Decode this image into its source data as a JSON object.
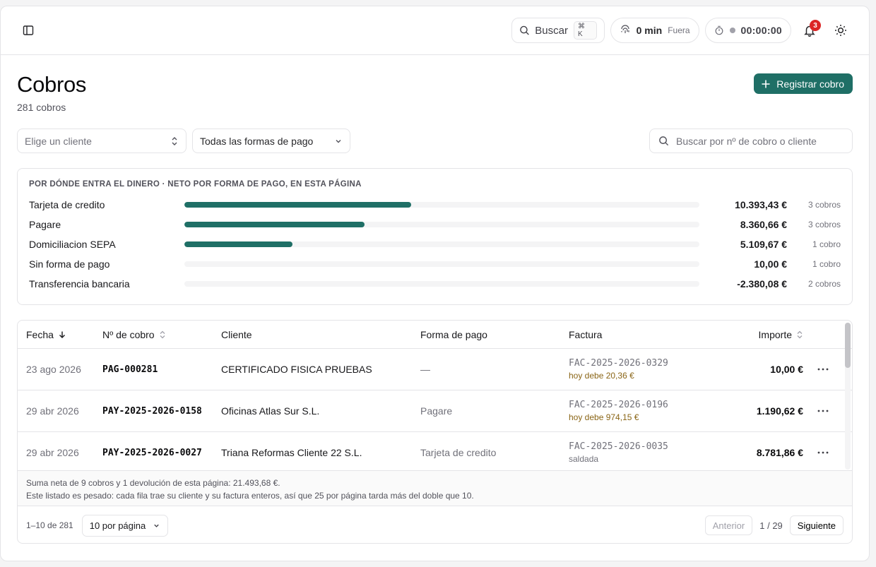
{
  "topbar": {
    "search_label": "Buscar",
    "search_shortcut": "⌘ K",
    "presence_minutes": "0 min",
    "presence_status": "Fuera",
    "timer": "00:00:00",
    "notifications_count": "3"
  },
  "page": {
    "title": "Cobros",
    "subtitle": "281 cobros",
    "primary_action": "Registrar cobro"
  },
  "filters": {
    "client_placeholder": "Elige un cliente",
    "payment_method": "Todas las formas de pago",
    "search_placeholder": "Buscar por nº de cobro o cliente"
  },
  "summary": {
    "title": "POR DÓNDE ENTRA EL DINERO · NETO POR FORMA DE PAGO, EN ESTA PÁGINA",
    "rows": [
      {
        "label": "Tarjeta de credito",
        "amount": "10.393,43 €",
        "count": "3 cobros",
        "share": 0.44
      },
      {
        "label": "Pagare",
        "amount": "8.360,66 €",
        "count": "3 cobros",
        "share": 0.35
      },
      {
        "label": "Domiciliacion SEPA",
        "amount": "5.109,67 €",
        "count": "1 cobro",
        "share": 0.21
      },
      {
        "label": "Sin forma de pago",
        "amount": "10,00 €",
        "count": "1 cobro",
        "share": 0
      },
      {
        "label": "Transferencia bancaria",
        "amount": "-2.380,08 €",
        "count": "2 cobros",
        "share": 0
      }
    ]
  },
  "table": {
    "columns": {
      "fecha": "Fecha",
      "numero": "Nº de cobro",
      "cliente": "Cliente",
      "forma": "Forma de pago",
      "factura": "Factura",
      "importe": "Importe"
    },
    "rows": [
      {
        "fecha": "23 ago 2026",
        "numero": "PAG-000281",
        "cliente": "CERTIFICADO FISICA PRUEBAS",
        "forma": "—",
        "factura": "FAC-2025-2026-0329",
        "factura_estado": "hoy debe 20,36 €",
        "importe": "10,00 €"
      },
      {
        "fecha": "29 abr 2026",
        "numero": "PAY-2025-2026-0158",
        "cliente": "Oficinas Atlas Sur S.L.",
        "forma": "Pagare",
        "factura": "FAC-2025-2026-0196",
        "factura_estado": "hoy debe 974,15 €",
        "importe": "1.190,62 €"
      },
      {
        "fecha": "29 abr 2026",
        "numero": "PAY-2025-2026-0027",
        "cliente": "Triana Reformas Cliente 22 S.L.",
        "forma": "Tarjeta de credito",
        "factura": "FAC-2025-2026-0035",
        "factura_estado": "saldada",
        "importe": "8.781,86 €"
      }
    ],
    "note_1": "Suma neta de 9 cobros y 1 devolución de esta página: 21.493,68 €.",
    "note_2": "Este listado es pesado: cada fila trae su cliente y su factura enteros, así que 25 por página tarda más del doble que 10."
  },
  "pagination": {
    "range": "1–10 de 281",
    "per_page": "10 por página",
    "prev": "Anterior",
    "page_info": "1 / 29",
    "next": "Siguiente"
  }
}
